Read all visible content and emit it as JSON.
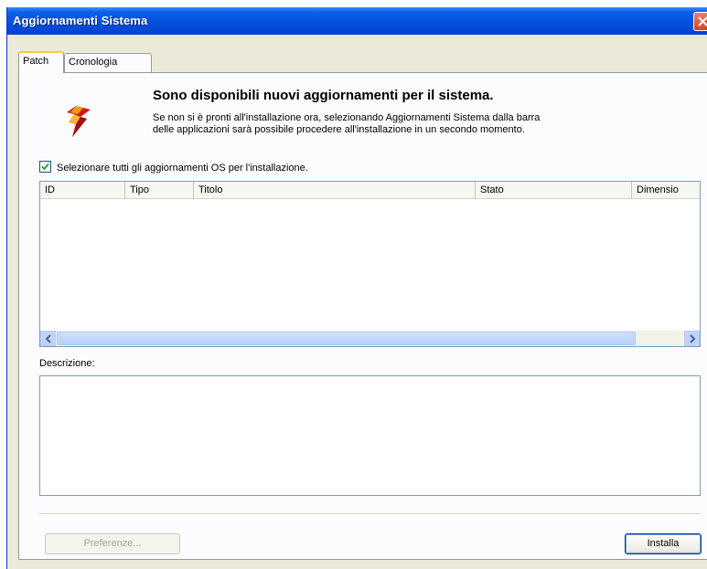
{
  "window": {
    "title": "Aggiornamenti Sistema"
  },
  "tabs": [
    {
      "label": "Patch",
      "active": true
    },
    {
      "label": "Cronologia",
      "active": false
    }
  ],
  "header": {
    "icon": "red-update-icon",
    "headline": "Sono disponibili nuovi aggiornamenti per il sistema.",
    "line1": "Se non si è pronti all'installazione ora, selezionando Aggiornamenti Sistema dalla barra",
    "line2": "delle applicazioni sarà possibile procedere all'installazione in un secondo momento."
  },
  "select_all": {
    "checked": true,
    "label": "Selezionare tutti gli aggiornamenti OS per l'installazione."
  },
  "updates_table": {
    "columns": [
      "ID",
      "Tipo",
      "Titolo",
      "Stato",
      "Dimensio"
    ],
    "rows": []
  },
  "description": {
    "label": "Descrizione:",
    "value": ""
  },
  "buttons": {
    "preferences": "Preferenze...",
    "install": "Installa"
  },
  "colors": {
    "titlebar": "#0553df",
    "dialog_bg": "#ece9d8",
    "focus_border": "#7b9ee8",
    "scroll_thumb": "#c1d3fb"
  }
}
